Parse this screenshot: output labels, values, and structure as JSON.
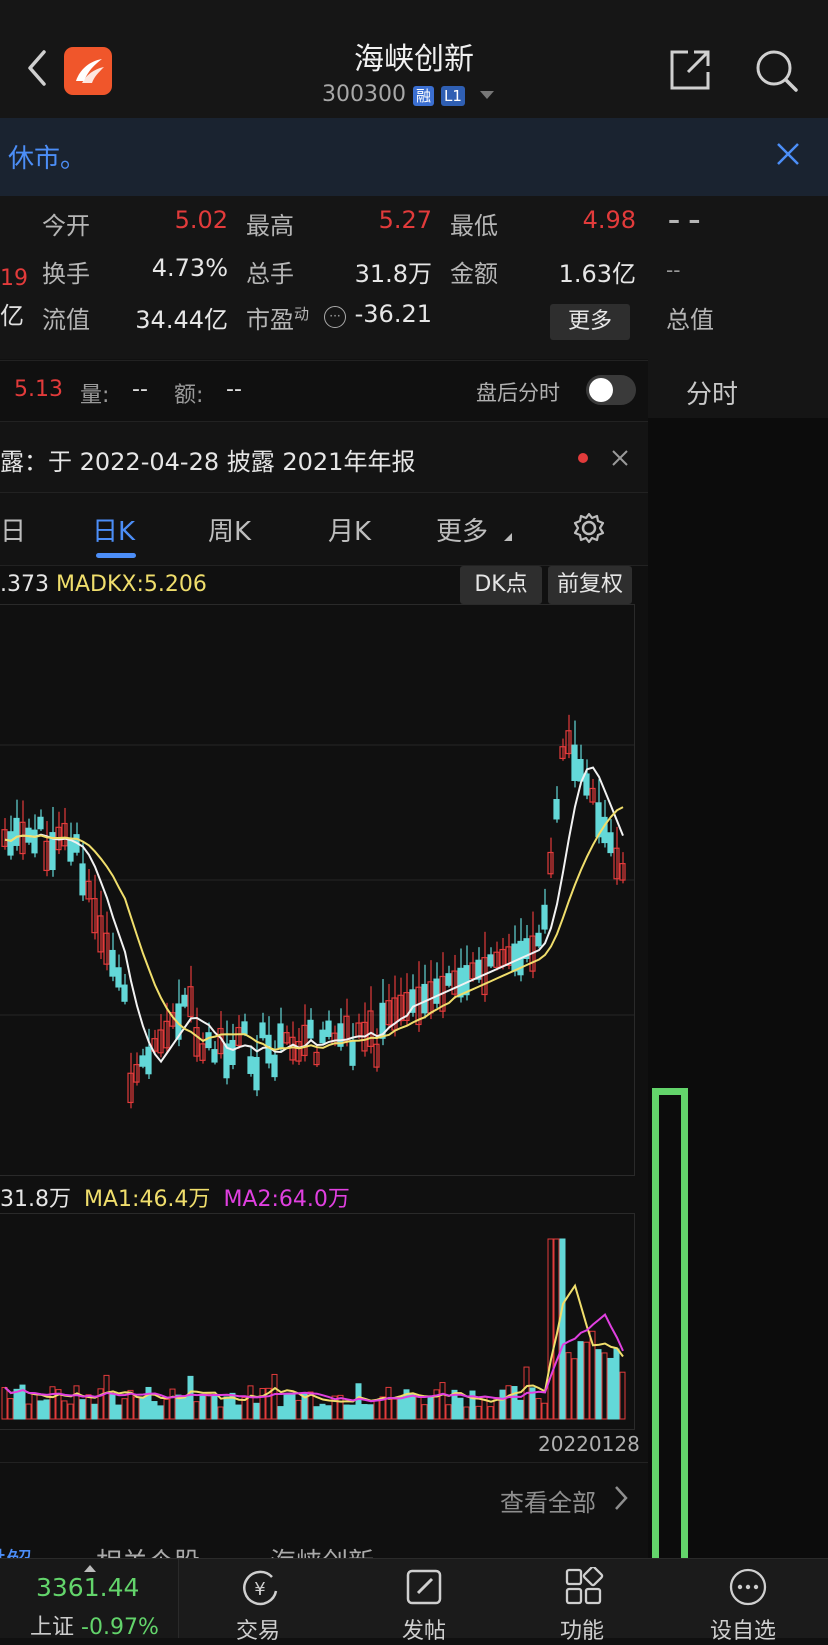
{
  "header": {
    "title": "海峡创新",
    "code": "300300",
    "badge_rong": "融",
    "badge_l1": "L1"
  },
  "notice": {
    "text": "休市。"
  },
  "quotes": {
    "open_label": "今开",
    "open_value": "5.02",
    "high_label": "最高",
    "high_value": "5.27",
    "low_label": "最低",
    "low_value": "4.98",
    "turnover_label": "换手",
    "turnover_value": "4.73%",
    "volume_label": "总手",
    "volume_value": "31.8万",
    "amount_label": "金额",
    "amount_value": "1.63亿",
    "float_cap_label": "流值",
    "float_cap_value": "34.44亿",
    "pe_label": "市盈",
    "pe_sup": "动",
    "pe_value": "-36.21",
    "more_label": "更多",
    "left_cut_1": "19",
    "left_cut_2": "亿",
    "right_dash_1": "– –",
    "right_dash_2": "--",
    "total_cap_label": "总值"
  },
  "afterhours": {
    "price": "5.13",
    "vol_label": "量:",
    "vol_value": "--",
    "amt_label": "额:",
    "amt_value": "--",
    "toggle_label": "盘后分时",
    "fenshi_tab": "分时"
  },
  "disclosure": {
    "text": "露：于 2022-04-28 披露 2021年年报"
  },
  "tabs": {
    "day_cut": "日",
    "daily_k": "日K",
    "weekly_k": "周K",
    "monthly_k": "月K",
    "more": "更多"
  },
  "indicator": {
    "left_value": ".373",
    "madkx": "MADKX:5.206",
    "dk_point": "DK点",
    "adjust": "前复权"
  },
  "volume_indicator": {
    "vol": "31.8万",
    "ma1": "MA1:46.4万",
    "ma2": "MA2:64.0万",
    "date": "20220128"
  },
  "view_all": "查看全部",
  "section_tabs": [
    "讲解",
    "相关个股",
    "海峡创新"
  ],
  "bottom": {
    "index_value": "3361.44",
    "index_name": "上证",
    "index_change": "-0.97%",
    "trade": "交易",
    "post": "发帖",
    "function": "功能",
    "watchlist": "设自选"
  },
  "colors": {
    "up": "#e23b3b",
    "down": "#63d8d8",
    "ma_white": "#f2f2f2",
    "ma_yellow": "#f0de6c",
    "ma_magenta": "#e040e0",
    "accent_blue": "#4c8ef7",
    "brand_orange": "#f0562b"
  }
}
